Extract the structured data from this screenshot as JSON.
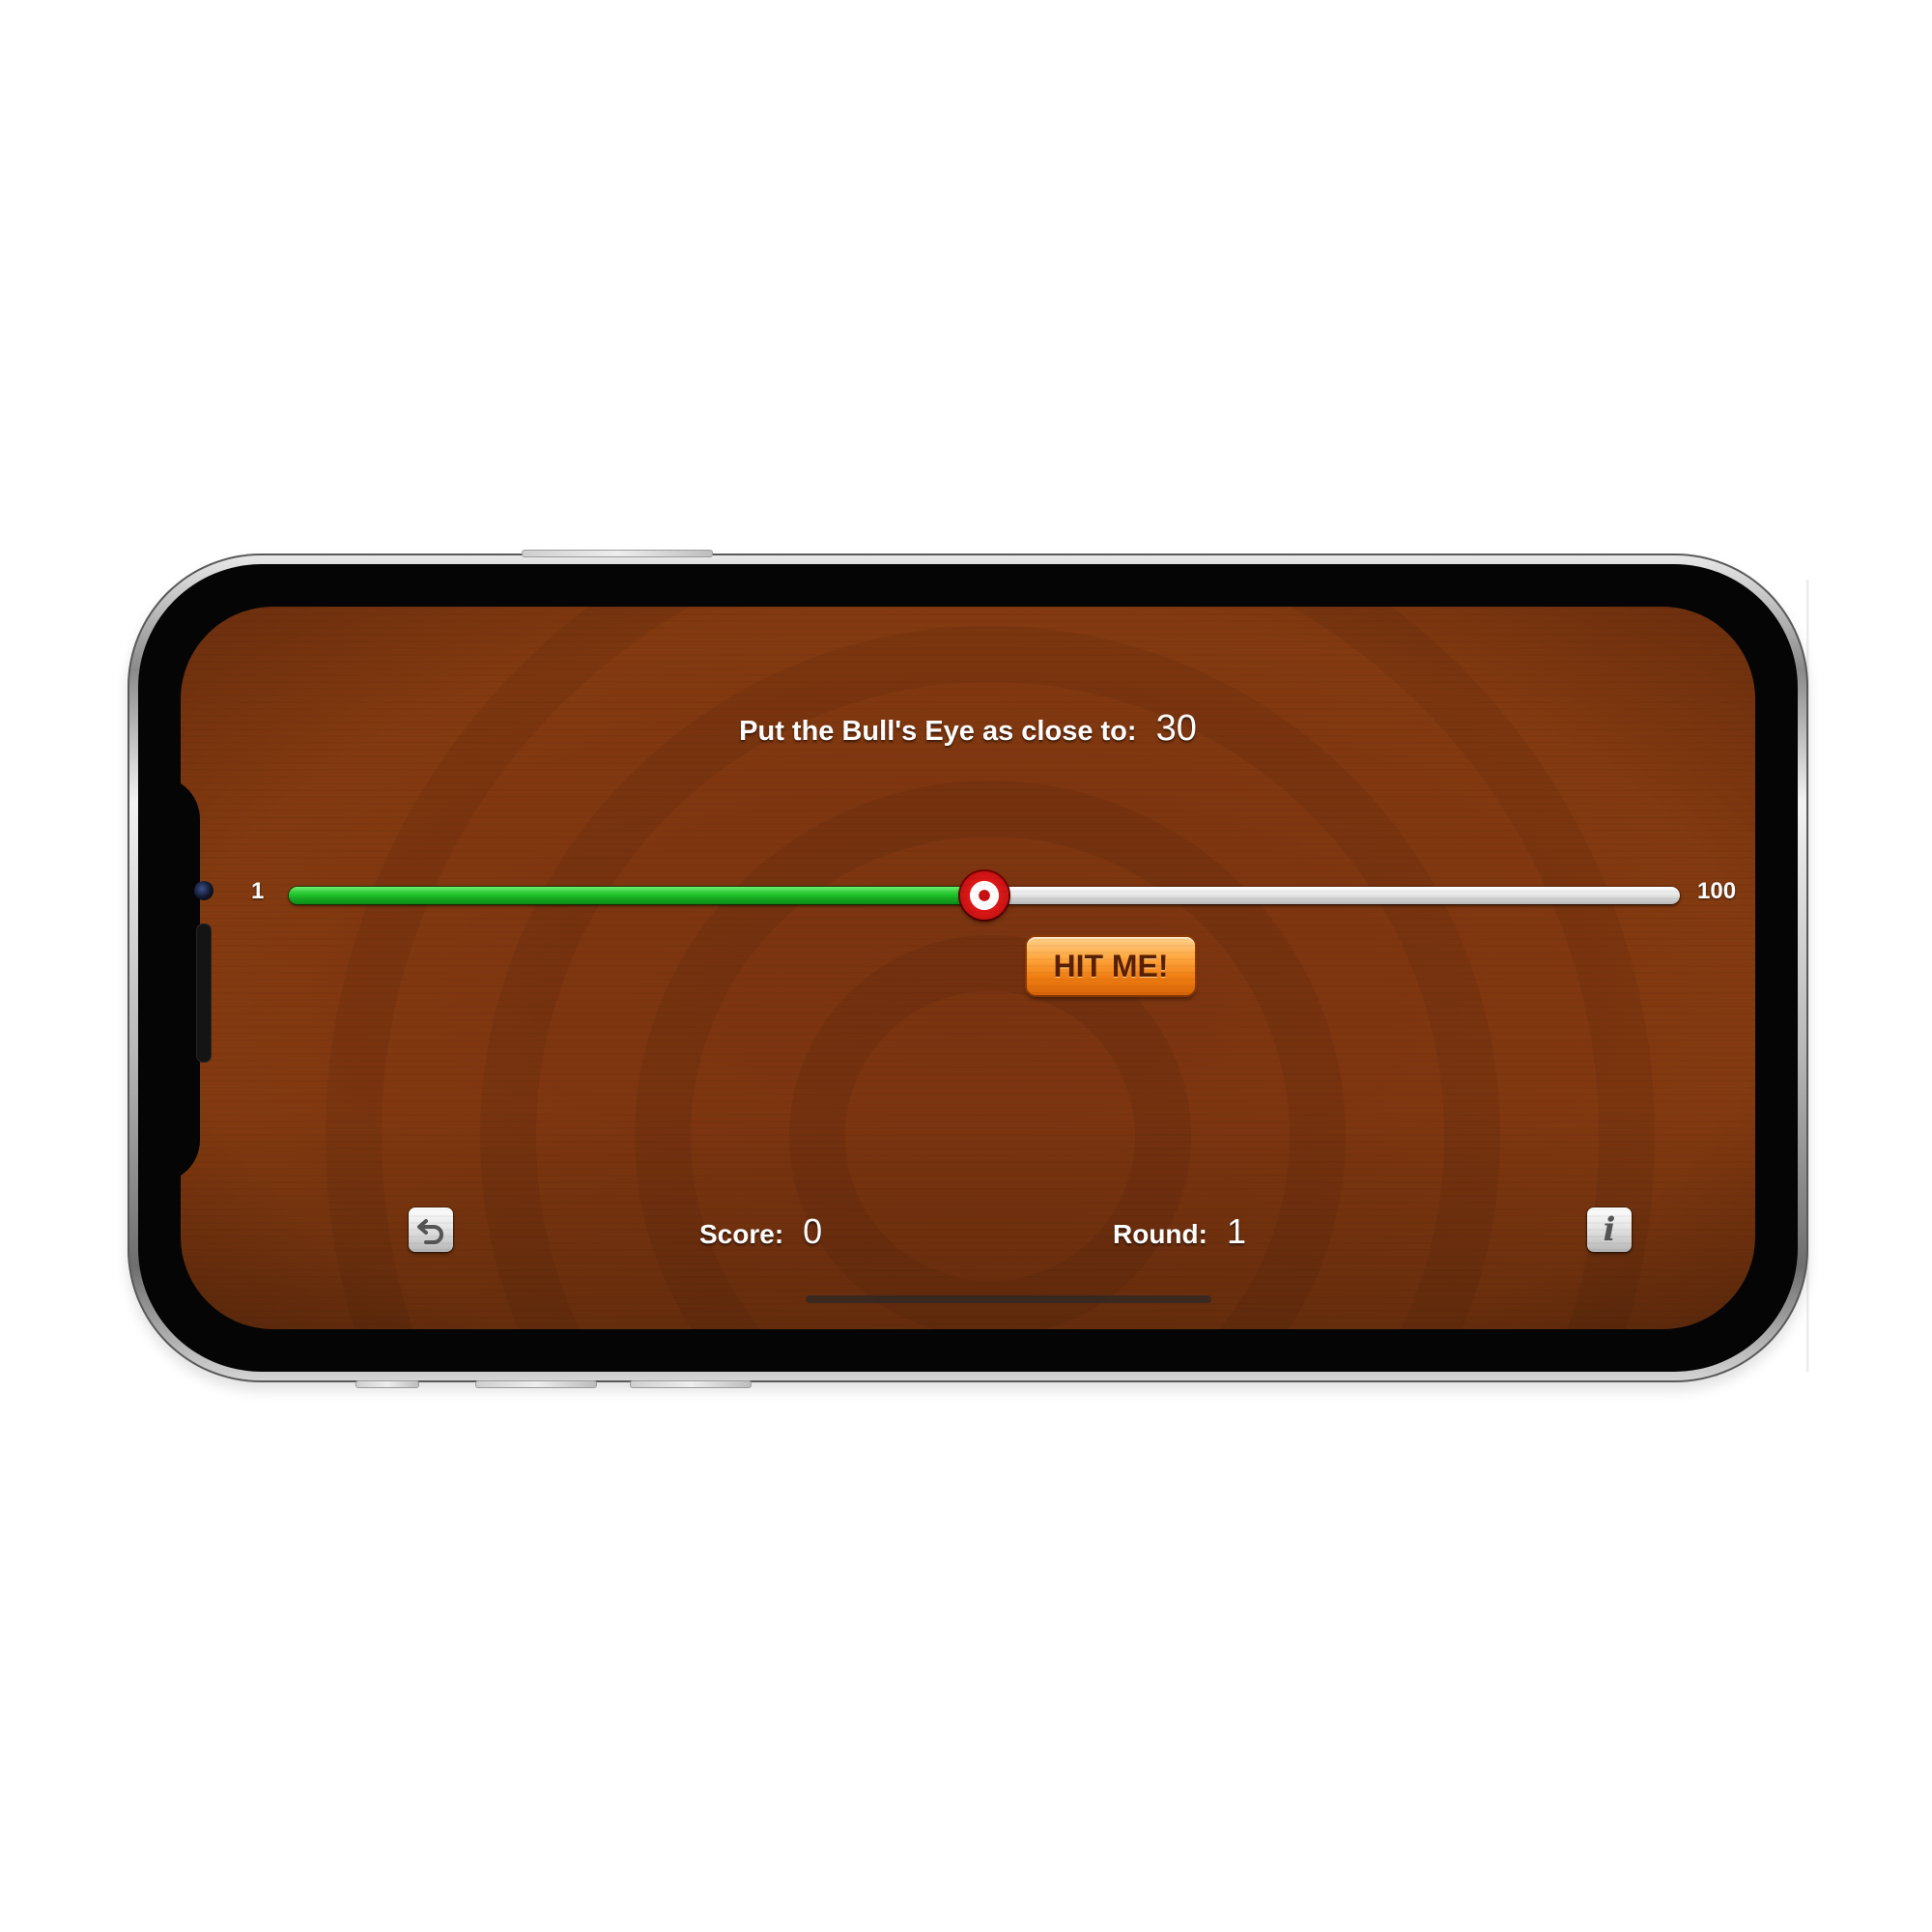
{
  "game": {
    "instruction_label": "Put the Bull's Eye as close to:",
    "target_value": "30",
    "slider": {
      "min_label": "1",
      "max_label": "100",
      "value_fraction": 0.5,
      "fill_color": "#1fc42a",
      "thumb_icon": "bullseye-icon"
    },
    "hit_button_label": "HIT ME!",
    "score_label": "Score:",
    "score_value": "0",
    "round_label": "Round:",
    "round_value": "1",
    "restart_icon": "restart-icon",
    "info_icon": "info-icon",
    "info_glyph": "i"
  },
  "theme": {
    "background": "#7e3610",
    "button_accent": "#f07d12",
    "text": "#ffffff"
  }
}
